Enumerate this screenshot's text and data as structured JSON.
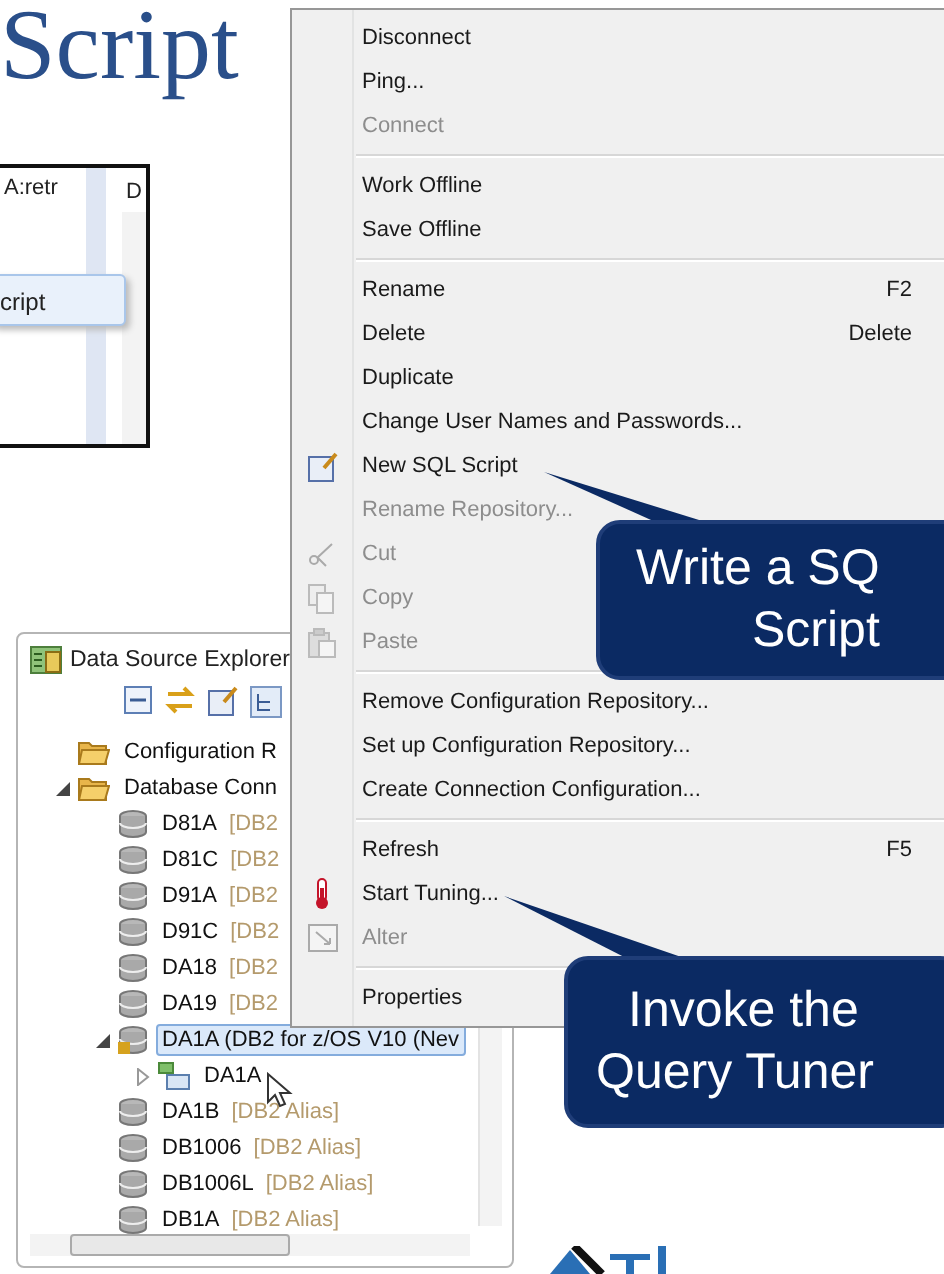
{
  "slide_title": "Script",
  "snippet": {
    "tab_label": "A:retr",
    "column_label": "D",
    "menu_item": "cript"
  },
  "explorer": {
    "title": "Data Source Explorer",
    "tree": [
      {
        "kind": "folder",
        "label": "Configuration R",
        "selected": false
      },
      {
        "kind": "folder",
        "label": "Database Conn",
        "expanded": true,
        "selected": false,
        "children": [
          {
            "kind": "database",
            "label": "D81A",
            "alias": "[DB2",
            "selected": false
          },
          {
            "kind": "database",
            "label": "D81C",
            "alias": "[DB2",
            "selected": false
          },
          {
            "kind": "database",
            "label": "D91A",
            "alias": "[DB2",
            "selected": false
          },
          {
            "kind": "database",
            "label": "D91C",
            "alias": "[DB2",
            "selected": false
          },
          {
            "kind": "database",
            "label": "DA18",
            "alias": "[DB2",
            "selected": false
          },
          {
            "kind": "database",
            "label": "DA19",
            "alias": "[DB2",
            "selected": false
          },
          {
            "kind": "connected",
            "label": "DA1A (DB2 for z/OS V10 (Nev",
            "expanded": true,
            "selected": true,
            "children": [
              {
                "kind": "schema",
                "label": "DA1A",
                "expanded": false,
                "selected": false
              }
            ]
          },
          {
            "kind": "database",
            "label": "DA1B",
            "alias": "[DB2 Alias]",
            "selected": false
          },
          {
            "kind": "database",
            "label": "DB1006",
            "alias": "[DB2 Alias]",
            "selected": false
          },
          {
            "kind": "database",
            "label": "DB1006L",
            "alias": "[DB2 Alias]",
            "selected": false
          },
          {
            "kind": "database",
            "label": "DB1A",
            "alias": "[DB2 Alias]",
            "selected": false
          }
        ]
      }
    ]
  },
  "context_menu": [
    [
      {
        "kind": "plain",
        "label": "Disconnect",
        "disabled": false
      },
      {
        "kind": "plain",
        "label": "Ping...",
        "disabled": false
      },
      {
        "kind": "plain",
        "label": "Connect",
        "disabled": true
      }
    ],
    [
      {
        "kind": "plain",
        "label": "Work Offline",
        "disabled": false
      },
      {
        "kind": "plain",
        "label": "Save Offline",
        "disabled": false
      }
    ],
    [
      {
        "kind": "plain",
        "label": "Rename",
        "shortcut": "F2",
        "disabled": false
      },
      {
        "kind": "plain",
        "label": "Delete",
        "shortcut": "Delete",
        "disabled": false
      },
      {
        "kind": "plain",
        "label": "Duplicate",
        "disabled": false
      },
      {
        "kind": "plain",
        "label": "Change User Names and Passwords...",
        "disabled": false
      },
      {
        "kind": "sql",
        "label": "New SQL Script",
        "disabled": false
      },
      {
        "kind": "plain",
        "label": "Rename Repository...",
        "disabled": true
      },
      {
        "kind": "cut",
        "label": "Cut",
        "disabled": true
      },
      {
        "kind": "copy",
        "label": "Copy",
        "disabled": true
      },
      {
        "kind": "paste",
        "label": "Paste",
        "disabled": true
      }
    ],
    [
      {
        "kind": "plain",
        "label": "Remove Configuration Repository...",
        "disabled": false
      },
      {
        "kind": "plain",
        "label": "Set up Configuration Repository...",
        "disabled": false
      },
      {
        "kind": "plain",
        "label": "Create Connection Configuration...",
        "disabled": false
      }
    ],
    [
      {
        "kind": "plain",
        "label": "Refresh",
        "shortcut": "F5",
        "disabled": false
      },
      {
        "kind": "tuning",
        "label": "Start Tuning...",
        "disabled": false
      },
      {
        "kind": "alter",
        "label": "Alter",
        "disabled": true
      }
    ],
    [
      {
        "kind": "plain",
        "label": "Properties",
        "disabled": false
      }
    ]
  ],
  "callouts": [
    {
      "lines": [
        "Write a SQ",
        "Script"
      ]
    },
    {
      "lines": [
        "Invoke the",
        "Query Tuner"
      ]
    }
  ]
}
